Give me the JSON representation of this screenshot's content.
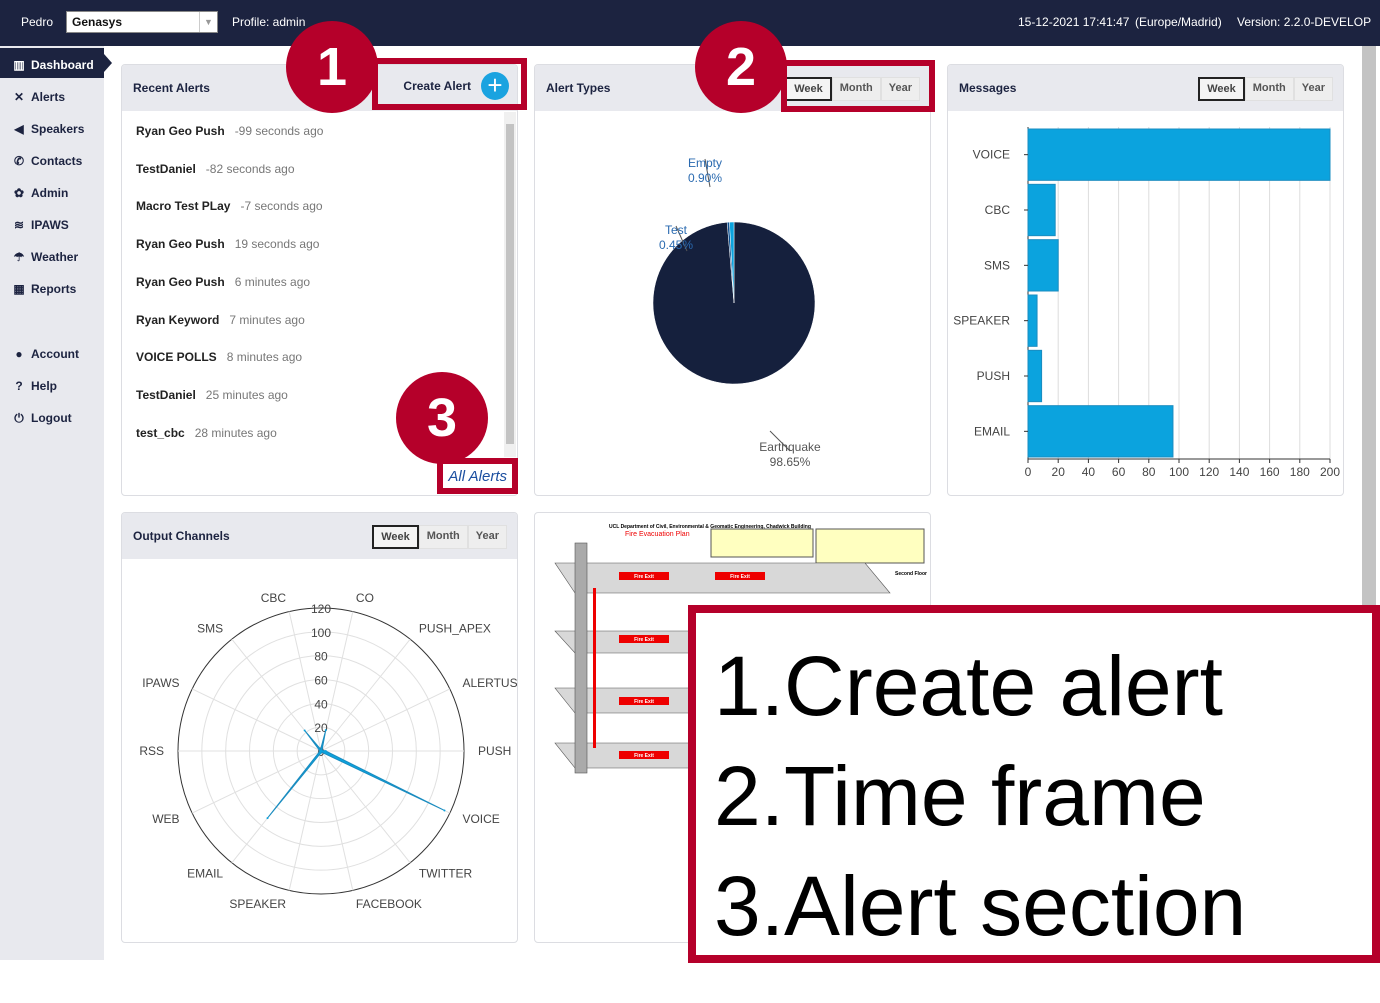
{
  "topbar": {
    "user": "Pedro",
    "org": "Genasys",
    "profile": "Profile: admin",
    "datetime": "15-12-2021 17:41:47",
    "timezone": "(Europe/Madrid)",
    "version": "Version: 2.2.0-DEVELOP"
  },
  "sidebar": {
    "items": [
      {
        "label": "Dashboard",
        "icon": "bar-chart-icon"
      },
      {
        "label": "Alerts",
        "icon": "expand-icon"
      },
      {
        "label": "Speakers",
        "icon": "volume-icon"
      },
      {
        "label": "Contacts",
        "icon": "phone-icon"
      },
      {
        "label": "Admin",
        "icon": "gear-icon"
      },
      {
        "label": "IPAWS",
        "icon": "wifi-icon"
      },
      {
        "label": "Weather",
        "icon": "umbrella-icon"
      },
      {
        "label": "Reports",
        "icon": "table-icon"
      },
      {
        "label": "Account",
        "icon": "user-icon"
      },
      {
        "label": "Help",
        "icon": "help-icon"
      },
      {
        "label": "Logout",
        "icon": "power-icon"
      }
    ]
  },
  "timeframe": {
    "week": "Week",
    "month": "Month",
    "year": "Year"
  },
  "recent_alerts": {
    "title": "Recent Alerts",
    "create": "Create Alert",
    "all": "All Alerts",
    "items": [
      {
        "name": "Ryan Geo Push",
        "time": "-99 seconds ago"
      },
      {
        "name": "TestDaniel",
        "time": "-82 seconds ago"
      },
      {
        "name": "Macro Test PLay",
        "time": "-7 seconds ago"
      },
      {
        "name": "Ryan Geo Push",
        "time": "19 seconds ago"
      },
      {
        "name": "Ryan Geo Push",
        "time": "6 minutes ago"
      },
      {
        "name": "Ryan Keyword",
        "time": "7 minutes ago"
      },
      {
        "name": "VOICE POLLS",
        "time": "8 minutes ago"
      },
      {
        "name": "TestDaniel",
        "time": "25 minutes ago"
      },
      {
        "name": "test_cbc",
        "time": "28 minutes ago"
      }
    ]
  },
  "alert_types": {
    "title": "Alert Types"
  },
  "messages": {
    "title": "Messages"
  },
  "output_channels": {
    "title": "Output Channels"
  },
  "floorplan": {
    "title": "UCL Department of Civil, Environmental & Geomatic Engineering, Chadwick Building",
    "subtitle": "Fire Evacuation Plan",
    "floor": "Second Floor",
    "exit": "Fire Exit"
  },
  "annotations": {
    "n1": "1",
    "n2": "2",
    "n3": "3",
    "lines": [
      "1.Create alert",
      "2.Time frame",
      "3.Alert section"
    ]
  },
  "colors": {
    "nav": "#1c2340",
    "bar": "#0ba3de",
    "pie_main": "#15203d",
    "pie_test": "#0d4f8f",
    "annot": "#b5002a"
  },
  "chart_data": [
    {
      "type": "pie",
      "categories": [
        "Earthquake",
        "Test",
        "Empty"
      ],
      "values": [
        98.65,
        0.45,
        0.9
      ],
      "labels": [
        "98.65%",
        "0.45%",
        "0.90%"
      ]
    },
    {
      "type": "bar",
      "orientation": "horizontal",
      "categories": [
        "VOICE",
        "CBC",
        "SMS",
        "SPEAKER",
        "PUSH",
        "EMAIL"
      ],
      "values": [
        200,
        18,
        20,
        6,
        9,
        96
      ],
      "xlim": [
        0,
        200
      ],
      "xticks": [
        0,
        20,
        40,
        60,
        80,
        100,
        120,
        140,
        160,
        180,
        200
      ],
      "grid": true
    },
    {
      "type": "radar",
      "categories": [
        "CBC",
        "CO",
        "PUSH_APEX",
        "ALERTUS",
        "PUSH",
        "VOICE",
        "TWITTER",
        "FACEBOOK",
        "SPEAKER",
        "EMAIL",
        "WEB",
        "RSS",
        "IPAWS",
        "SMS"
      ],
      "values": [
        0,
        18,
        0,
        0,
        4,
        115,
        0,
        0,
        2,
        72,
        0,
        0,
        0,
        22
      ],
      "rlim": [
        0,
        120
      ],
      "rticks": [
        0,
        20,
        40,
        60,
        80,
        100,
        120
      ]
    }
  ]
}
